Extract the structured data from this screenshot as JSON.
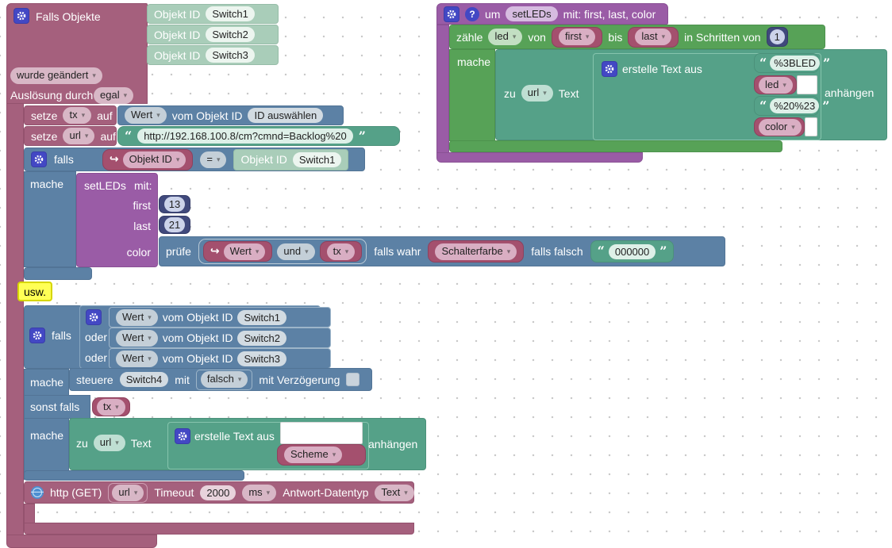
{
  "left": {
    "trigger": {
      "title": "Falls Objekte",
      "object_rows": [
        {
          "label": "Objekt ID",
          "value": "Switch1"
        },
        {
          "label": "Objekt ID",
          "value": "Switch2"
        },
        {
          "label": "Objekt ID",
          "value": "Switch3"
        }
      ],
      "change_mode": "wurde geändert",
      "ausloesung_label": "Auslösung durch",
      "ausloesung_value": "egal"
    },
    "set_tx": {
      "kw": "setze",
      "var": "tx",
      "kw2": "auf",
      "val": {
        "selector": "Wert",
        "label": "vom Objekt ID",
        "id": "ID auswählen"
      }
    },
    "set_url": {
      "kw": "setze",
      "var": "url",
      "kw2": "auf",
      "value": "http://192.168.100.8/cm?cmnd=Backlog%20"
    },
    "if1": {
      "kw": "falls",
      "left_var": "Objekt ID",
      "op": "=",
      "right_label": "Objekt ID",
      "right_value": "Switch1",
      "do_label": "mache",
      "call": {
        "name": "setLEDs",
        "mit": "mit:",
        "p1": "first",
        "v1": "13",
        "p2": "last",
        "v2": "21",
        "p3": "color"
      },
      "check": {
        "kw": "prüfe",
        "a": "Wert",
        "op": "und",
        "b": "tx",
        "true_label": "falls wahr",
        "true_value": "Schalterfarbe",
        "false_label": "falls falsch",
        "false_value": "000000"
      }
    },
    "comment": "usw.",
    "if2": {
      "kw": "falls",
      "rows": [
        {
          "op": "",
          "selector": "Wert",
          "label": "vom Objekt ID",
          "id": "Switch1"
        },
        {
          "op": "oder",
          "selector": "Wert",
          "label": "vom Objekt ID",
          "id": "Switch2"
        },
        {
          "op": "oder",
          "selector": "Wert",
          "label": "vom Objekt ID",
          "id": "Switch3"
        }
      ],
      "do_label": "mache",
      "control": {
        "kw": "steuere",
        "id": "Switch4",
        "mit": "mit",
        "value": "falsch",
        "delay": "mit Verzögerung"
      },
      "elseif_label": "sonst falls",
      "elseif_var": "tx",
      "do2_label": "mache",
      "append": {
        "zu": "zu",
        "var": "url",
        "text": "Text",
        "create": "erstelle Text aus",
        "item2": "Scheme",
        "suffix": "anhängen"
      }
    },
    "http": {
      "kw": "http (GET)",
      "var": "url",
      "timeout_label": "Timeout",
      "timeout": "2000",
      "unit": "ms",
      "resp_label": "Antwort-Datentyp",
      "resp": "Text"
    }
  },
  "right": {
    "def": {
      "um": "um",
      "name": "setLEDs",
      "params": "mit: first, last, color"
    },
    "loop": {
      "kw": "zähle",
      "var": "led",
      "von": "von",
      "from": "first",
      "bis": "bis",
      "to": "last",
      "step_label": "in Schritten von",
      "step": "1",
      "do_label": "mache"
    },
    "append": {
      "zu": "zu",
      "var": "url",
      "text": "Text",
      "create": "erstelle Text aus",
      "item1": "%3BLED",
      "item2": "led",
      "item3": "%20%23",
      "item4": "color",
      "suffix": "anhängen"
    }
  }
}
